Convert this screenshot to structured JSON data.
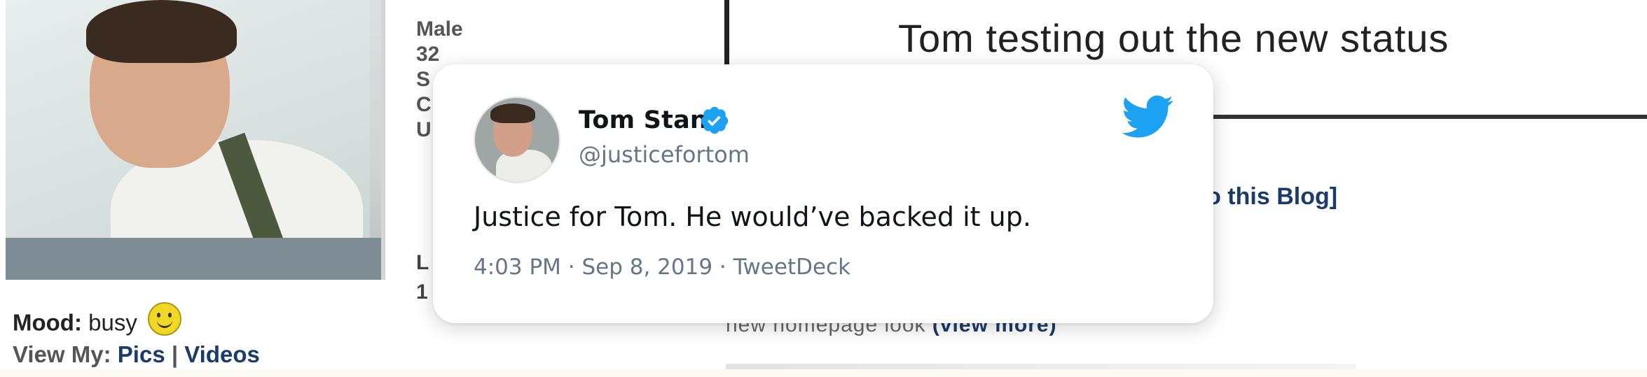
{
  "profile": {
    "info_lines": [
      "Male",
      "32",
      "S",
      "C",
      "U"
    ],
    "lower_lines": [
      "L",
      "1"
    ],
    "mood_label": "Mood:",
    "mood_value": "busy",
    "view_my_label": "View My:",
    "view_pics": "Pics",
    "view_sep": "|",
    "view_videos": "Videos",
    "status_title": "Tom testing out the new status",
    "blog_link": ": to this Blog]",
    "homepage_text": "new homepage look",
    "homepage_link": "(view more)"
  },
  "tweet": {
    "name": "Tom Stan",
    "handle": "@justicefortom",
    "text": "Justice for Tom. He would’ve backed it up.",
    "meta": "4:03 PM · Sep 8, 2019 · TweetDeck",
    "verified": true,
    "brand_color": "#1DA1F2"
  },
  "icons": {
    "verified": "verified-badge-icon",
    "platform": "twitter-bird-icon",
    "mood": "smiley-icon"
  }
}
